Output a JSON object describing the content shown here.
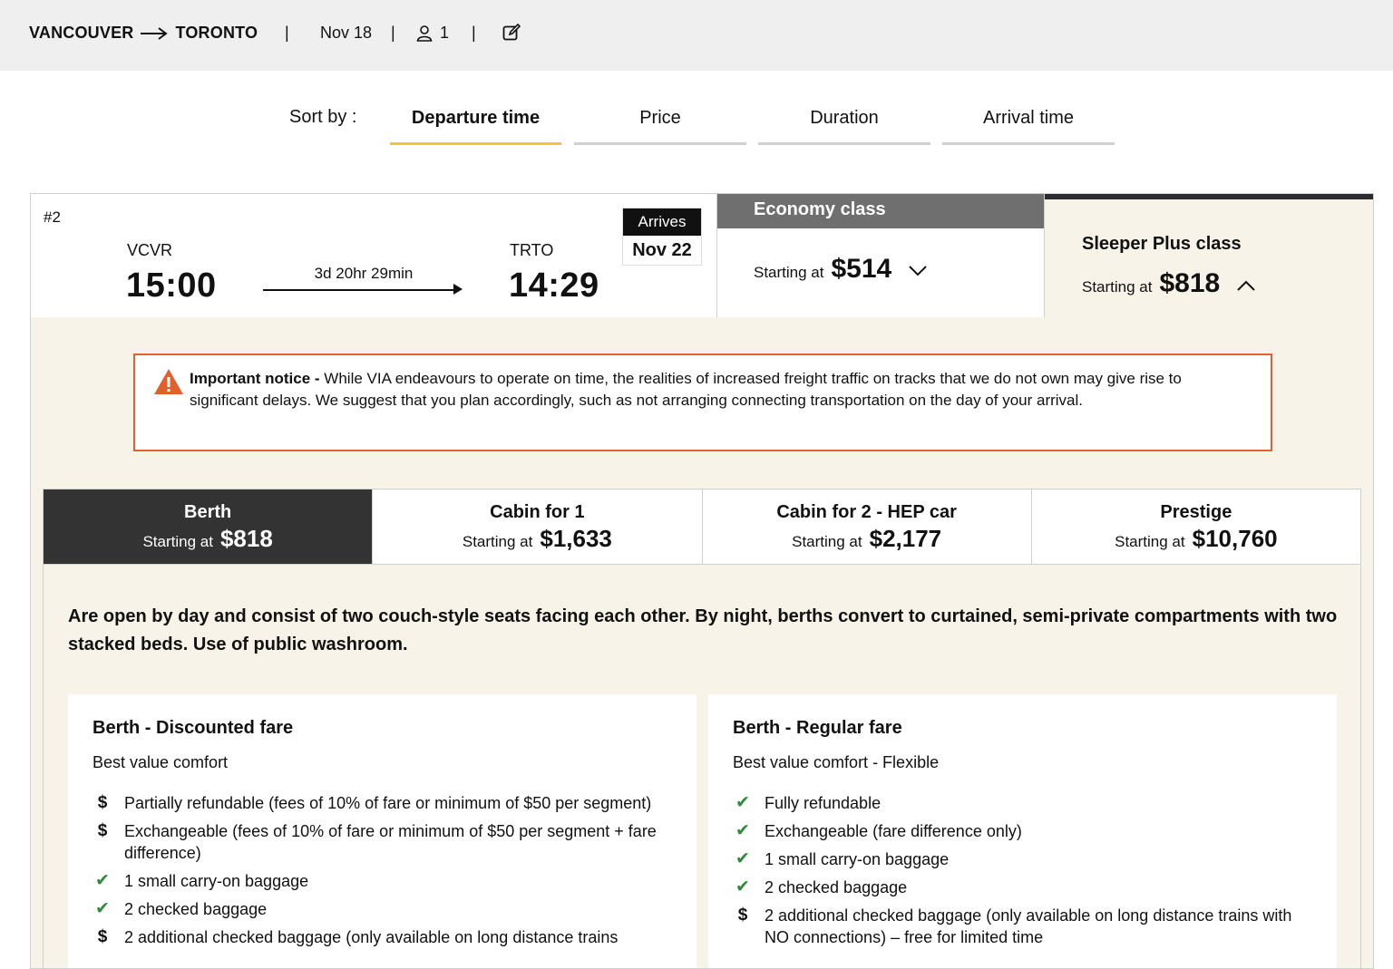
{
  "header": {
    "origin": "VANCOUVER",
    "destination": "TORONTO",
    "date": "Nov 18",
    "passengers": "1",
    "separator": "|"
  },
  "sort": {
    "label": "Sort by :",
    "tabs": [
      {
        "label": "Departure time",
        "active": true
      },
      {
        "label": "Price",
        "active": false
      },
      {
        "label": "Duration",
        "active": false
      },
      {
        "label": "Arrival time",
        "active": false
      }
    ]
  },
  "train": {
    "rank": "#2",
    "origin_code": "VCVR",
    "dest_code": "TRTO",
    "depart_time": "15:00",
    "arrive_time": "14:29",
    "duration": "3d 20hr 29min",
    "arrives_label": "Arrives",
    "arrives_date": "Nov 22",
    "economy": {
      "title": "Economy class",
      "starting_label": "Starting at",
      "price": "$514"
    },
    "sleeper": {
      "title": "Sleeper Plus class",
      "starting_label": "Starting at",
      "price": "$818"
    }
  },
  "notice": {
    "title": "Important notice -",
    "text": "While VIA endeavours to operate on time, the realities of increased freight traffic on tracks that we do not own may give rise to significant delays. We suggest that you plan accordingly, such as not arranging connecting transportation on the day of your arrival."
  },
  "cabins": [
    {
      "name": "Berth",
      "starting_label": "Starting at",
      "price": "$818",
      "active": true
    },
    {
      "name": "Cabin for 1",
      "starting_label": "Starting at",
      "price": "$1,633",
      "active": false
    },
    {
      "name": "Cabin for 2 - HEP car",
      "starting_label": "Starting at",
      "price": "$2,177",
      "active": false
    },
    {
      "name": "Prestige",
      "starting_label": "Starting at",
      "price": "$10,760",
      "active": false
    }
  ],
  "description": "Are open by day and consist of two couch-style seats facing each other. By night, berths convert to curtained, semi-private compartments with two stacked beds. Use of public washroom.",
  "fares": [
    {
      "title": "Berth - Discounted fare",
      "subtitle": "Best value comfort",
      "features": [
        {
          "icon": "dollar",
          "text": "Partially refundable (fees of 10% of fare or minimum of $50 per segment)"
        },
        {
          "icon": "dollar",
          "text": "Exchangeable (fees of 10% of fare or minimum of $50 per segment + fare difference)"
        },
        {
          "icon": "check",
          "text": "1 small carry-on baggage"
        },
        {
          "icon": "check",
          "text": "2 checked baggage"
        },
        {
          "icon": "dollar",
          "text": "2 additional checked baggage (only available on long distance trains"
        }
      ]
    },
    {
      "title": "Berth - Regular fare",
      "subtitle": "Best value comfort - Flexible",
      "features": [
        {
          "icon": "check",
          "text": "Fully refundable"
        },
        {
          "icon": "check",
          "text": "Exchangeable (fare difference only)"
        },
        {
          "icon": "check",
          "text": "1 small carry-on baggage"
        },
        {
          "icon": "check",
          "text": "2 checked baggage"
        },
        {
          "icon": "dollar",
          "text": "2 additional checked baggage (only available on long distance trains with NO connections) – free for limited time"
        }
      ]
    }
  ],
  "icons": {
    "check_symbol": "✔",
    "dollar_symbol": "$",
    "accent": "#f0c63c",
    "notice_border": "#e0612c",
    "check_color": "#2e8b3a"
  }
}
